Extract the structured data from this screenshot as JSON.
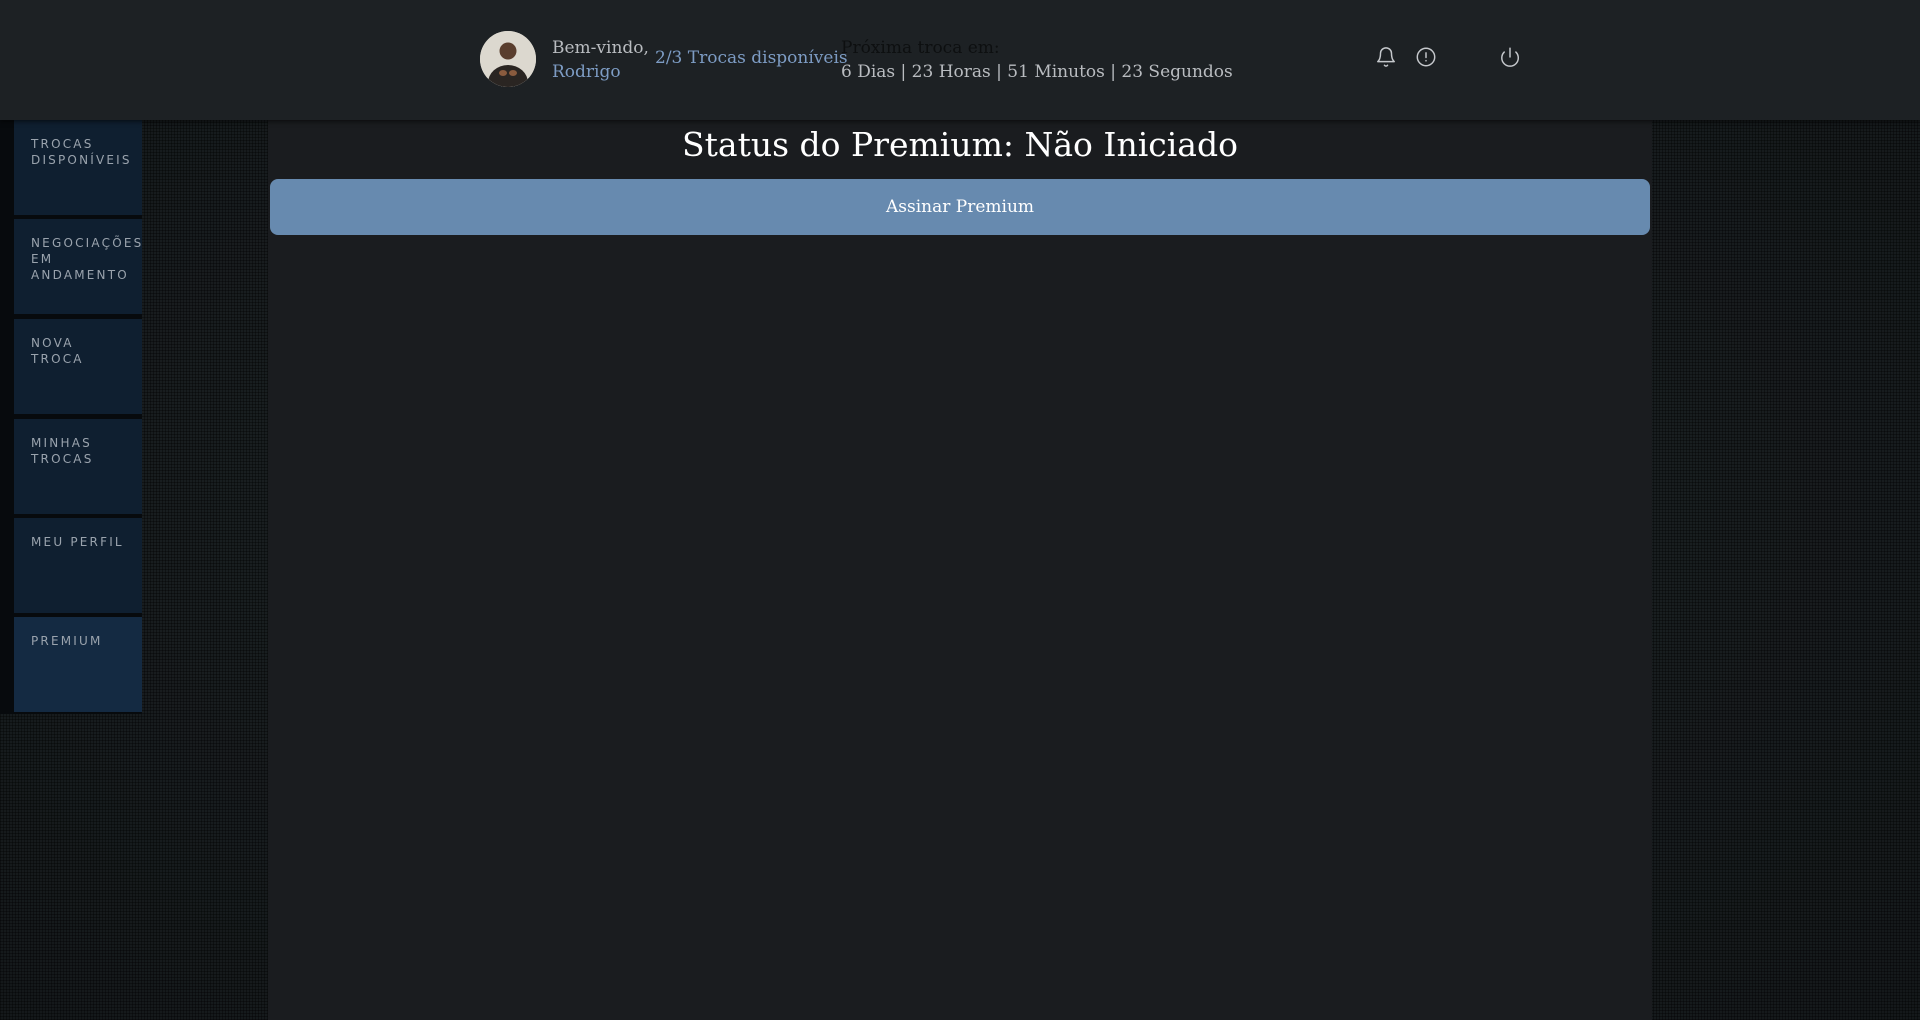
{
  "header": {
    "welcome_text": "Bem-vindo,",
    "user_name": "Rodrigo",
    "trades_available": "2/3 Trocas disponíveis",
    "next_trade_label": "Próxima troca em:",
    "next_trade_countdown": "6 Dias | 23 Horas | 51 Minutos | 23 Segundos",
    "icons": [
      "bell-icon",
      "alert-circle-icon",
      "power-icon"
    ]
  },
  "sidebar": {
    "items": [
      {
        "label": "TROCAS\nDISPONÍVEIS"
      },
      {
        "label": "NEGOCIAÇÕES\nEM\nANDAMENTO"
      },
      {
        "label": "NOVA\nTROCA"
      },
      {
        "label": "MINHAS\nTROCAS"
      },
      {
        "label": "MEU PERFIL"
      },
      {
        "label": "PREMIUM"
      }
    ]
  },
  "main": {
    "title": "Status do Premium: Não Iniciado",
    "subscribe_button": "Assinar Premium"
  },
  "colors": {
    "accent": "#7d9cc4",
    "button": "#678aaf",
    "sidebar_item": "#0f1f30",
    "panel": "#1a1c1f",
    "header": "#1d2124"
  }
}
